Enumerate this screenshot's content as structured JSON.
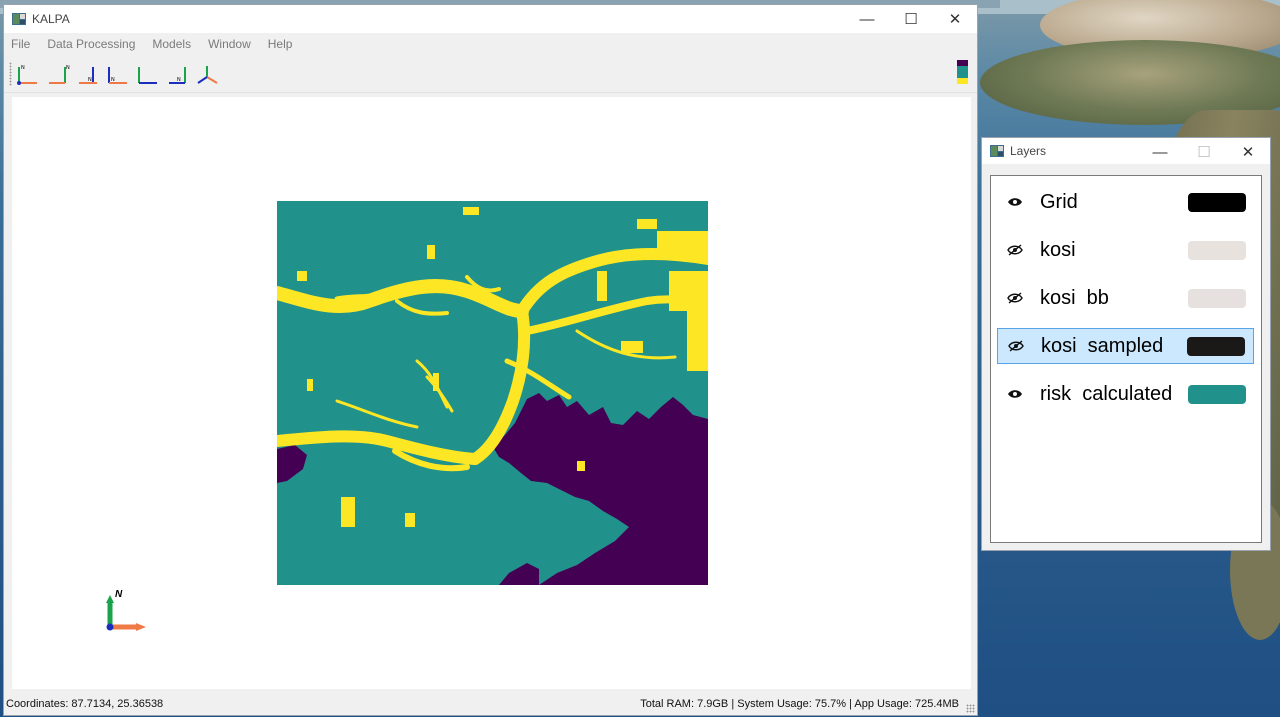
{
  "desktop": {
    "wallpaper": "coastal-islands-aerial"
  },
  "main_window": {
    "title": "KALPA",
    "controls": {
      "minimize": "—",
      "maximize": "☐",
      "close": "✕"
    },
    "menu": [
      "File",
      "Data Processing",
      "Models",
      "Window",
      "Help"
    ],
    "toolbar_icons": [
      "view-axis-yz-icon",
      "view-axis-zy-icon",
      "view-axis-xz-icon",
      "view-axis-xz-alt-icon",
      "view-axis-xy-icon",
      "view-axis-yx-icon",
      "view-axis-3d-icon"
    ],
    "colorbar": [
      "#440154",
      "#21918c",
      "#fde725"
    ],
    "raster": {
      "colors": {
        "low": "#440154",
        "medium": "#21918c",
        "high": "#fde725"
      }
    },
    "north_label": "N",
    "status": {
      "coordinates": "Coordinates: 87.7134, 25.36538",
      "resources": "Total RAM: 7.9GB | System Usage: 75.7% | App Usage: 725.4MB"
    }
  },
  "layers_window": {
    "title": "Layers",
    "controls": {
      "minimize": "—",
      "maximize": "☐",
      "close": "✕"
    },
    "layers": [
      {
        "name": "Grid",
        "visible": true,
        "color": "#000000",
        "selected": false
      },
      {
        "name": "kosi",
        "visible": false,
        "color": "#e8e2df",
        "selected": false
      },
      {
        "name": "kosi  bb",
        "visible": false,
        "color": "#e6e1de",
        "selected": false
      },
      {
        "name": "kosi  sampled",
        "visible": false,
        "color": "#1b1918",
        "selected": true
      },
      {
        "name": "risk  calculated",
        "visible": true,
        "color": "#21918c",
        "selected": false
      }
    ]
  }
}
